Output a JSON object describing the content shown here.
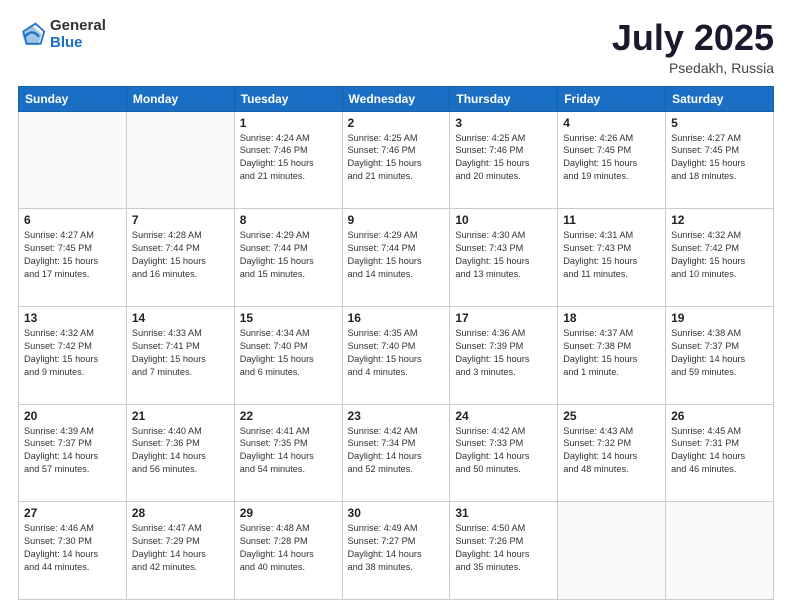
{
  "header": {
    "logo_general": "General",
    "logo_blue": "Blue",
    "month_title": "July 2025",
    "location": "Psedakh, Russia"
  },
  "days_of_week": [
    "Sunday",
    "Monday",
    "Tuesday",
    "Wednesday",
    "Thursday",
    "Friday",
    "Saturday"
  ],
  "weeks": [
    [
      {
        "day": "",
        "empty": true
      },
      {
        "day": "",
        "empty": true
      },
      {
        "day": "1",
        "line1": "Sunrise: 4:24 AM",
        "line2": "Sunset: 7:46 PM",
        "line3": "Daylight: 15 hours",
        "line4": "and 21 minutes."
      },
      {
        "day": "2",
        "line1": "Sunrise: 4:25 AM",
        "line2": "Sunset: 7:46 PM",
        "line3": "Daylight: 15 hours",
        "line4": "and 21 minutes."
      },
      {
        "day": "3",
        "line1": "Sunrise: 4:25 AM",
        "line2": "Sunset: 7:46 PM",
        "line3": "Daylight: 15 hours",
        "line4": "and 20 minutes."
      },
      {
        "day": "4",
        "line1": "Sunrise: 4:26 AM",
        "line2": "Sunset: 7:45 PM",
        "line3": "Daylight: 15 hours",
        "line4": "and 19 minutes."
      },
      {
        "day": "5",
        "line1": "Sunrise: 4:27 AM",
        "line2": "Sunset: 7:45 PM",
        "line3": "Daylight: 15 hours",
        "line4": "and 18 minutes."
      }
    ],
    [
      {
        "day": "6",
        "line1": "Sunrise: 4:27 AM",
        "line2": "Sunset: 7:45 PM",
        "line3": "Daylight: 15 hours",
        "line4": "and 17 minutes."
      },
      {
        "day": "7",
        "line1": "Sunrise: 4:28 AM",
        "line2": "Sunset: 7:44 PM",
        "line3": "Daylight: 15 hours",
        "line4": "and 16 minutes."
      },
      {
        "day": "8",
        "line1": "Sunrise: 4:29 AM",
        "line2": "Sunset: 7:44 PM",
        "line3": "Daylight: 15 hours",
        "line4": "and 15 minutes."
      },
      {
        "day": "9",
        "line1": "Sunrise: 4:29 AM",
        "line2": "Sunset: 7:44 PM",
        "line3": "Daylight: 15 hours",
        "line4": "and 14 minutes."
      },
      {
        "day": "10",
        "line1": "Sunrise: 4:30 AM",
        "line2": "Sunset: 7:43 PM",
        "line3": "Daylight: 15 hours",
        "line4": "and 13 minutes."
      },
      {
        "day": "11",
        "line1": "Sunrise: 4:31 AM",
        "line2": "Sunset: 7:43 PM",
        "line3": "Daylight: 15 hours",
        "line4": "and 11 minutes."
      },
      {
        "day": "12",
        "line1": "Sunrise: 4:32 AM",
        "line2": "Sunset: 7:42 PM",
        "line3": "Daylight: 15 hours",
        "line4": "and 10 minutes."
      }
    ],
    [
      {
        "day": "13",
        "line1": "Sunrise: 4:32 AM",
        "line2": "Sunset: 7:42 PM",
        "line3": "Daylight: 15 hours",
        "line4": "and 9 minutes."
      },
      {
        "day": "14",
        "line1": "Sunrise: 4:33 AM",
        "line2": "Sunset: 7:41 PM",
        "line3": "Daylight: 15 hours",
        "line4": "and 7 minutes."
      },
      {
        "day": "15",
        "line1": "Sunrise: 4:34 AM",
        "line2": "Sunset: 7:40 PM",
        "line3": "Daylight: 15 hours",
        "line4": "and 6 minutes."
      },
      {
        "day": "16",
        "line1": "Sunrise: 4:35 AM",
        "line2": "Sunset: 7:40 PM",
        "line3": "Daylight: 15 hours",
        "line4": "and 4 minutes."
      },
      {
        "day": "17",
        "line1": "Sunrise: 4:36 AM",
        "line2": "Sunset: 7:39 PM",
        "line3": "Daylight: 15 hours",
        "line4": "and 3 minutes."
      },
      {
        "day": "18",
        "line1": "Sunrise: 4:37 AM",
        "line2": "Sunset: 7:38 PM",
        "line3": "Daylight: 15 hours",
        "line4": "and 1 minute."
      },
      {
        "day": "19",
        "line1": "Sunrise: 4:38 AM",
        "line2": "Sunset: 7:37 PM",
        "line3": "Daylight: 14 hours",
        "line4": "and 59 minutes."
      }
    ],
    [
      {
        "day": "20",
        "line1": "Sunrise: 4:39 AM",
        "line2": "Sunset: 7:37 PM",
        "line3": "Daylight: 14 hours",
        "line4": "and 57 minutes."
      },
      {
        "day": "21",
        "line1": "Sunrise: 4:40 AM",
        "line2": "Sunset: 7:36 PM",
        "line3": "Daylight: 14 hours",
        "line4": "and 56 minutes."
      },
      {
        "day": "22",
        "line1": "Sunrise: 4:41 AM",
        "line2": "Sunset: 7:35 PM",
        "line3": "Daylight: 14 hours",
        "line4": "and 54 minutes."
      },
      {
        "day": "23",
        "line1": "Sunrise: 4:42 AM",
        "line2": "Sunset: 7:34 PM",
        "line3": "Daylight: 14 hours",
        "line4": "and 52 minutes."
      },
      {
        "day": "24",
        "line1": "Sunrise: 4:42 AM",
        "line2": "Sunset: 7:33 PM",
        "line3": "Daylight: 14 hours",
        "line4": "and 50 minutes."
      },
      {
        "day": "25",
        "line1": "Sunrise: 4:43 AM",
        "line2": "Sunset: 7:32 PM",
        "line3": "Daylight: 14 hours",
        "line4": "and 48 minutes."
      },
      {
        "day": "26",
        "line1": "Sunrise: 4:45 AM",
        "line2": "Sunset: 7:31 PM",
        "line3": "Daylight: 14 hours",
        "line4": "and 46 minutes."
      }
    ],
    [
      {
        "day": "27",
        "line1": "Sunrise: 4:46 AM",
        "line2": "Sunset: 7:30 PM",
        "line3": "Daylight: 14 hours",
        "line4": "and 44 minutes."
      },
      {
        "day": "28",
        "line1": "Sunrise: 4:47 AM",
        "line2": "Sunset: 7:29 PM",
        "line3": "Daylight: 14 hours",
        "line4": "and 42 minutes."
      },
      {
        "day": "29",
        "line1": "Sunrise: 4:48 AM",
        "line2": "Sunset: 7:28 PM",
        "line3": "Daylight: 14 hours",
        "line4": "and 40 minutes."
      },
      {
        "day": "30",
        "line1": "Sunrise: 4:49 AM",
        "line2": "Sunset: 7:27 PM",
        "line3": "Daylight: 14 hours",
        "line4": "and 38 minutes."
      },
      {
        "day": "31",
        "line1": "Sunrise: 4:50 AM",
        "line2": "Sunset: 7:26 PM",
        "line3": "Daylight: 14 hours",
        "line4": "and 35 minutes."
      },
      {
        "day": "",
        "empty": true
      },
      {
        "day": "",
        "empty": true
      }
    ]
  ]
}
